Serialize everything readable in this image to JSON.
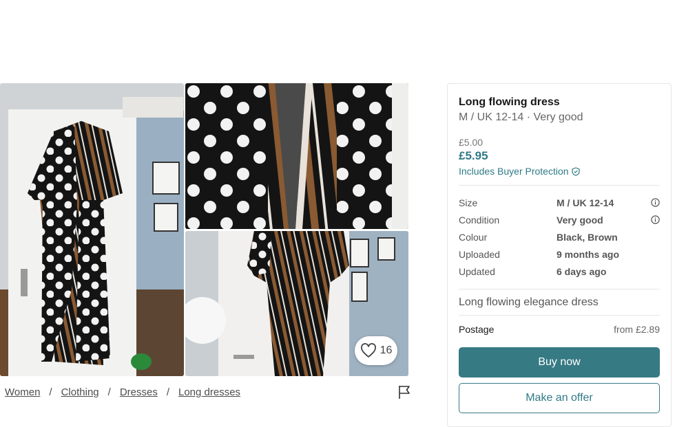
{
  "gallery": {
    "favourite_count": "16"
  },
  "breadcrumb": [
    "Women",
    "Clothing",
    "Dresses",
    "Long dresses"
  ],
  "item": {
    "title": "Long flowing dress",
    "subtitle": "M / UK 12-14 · Very good",
    "price": "£5.00",
    "price_with_protection": "£5.95",
    "protection_label": "Includes Buyer Protection",
    "attributes": [
      {
        "key": "Size",
        "value": "M / UK 12-14",
        "info": true
      },
      {
        "key": "Condition",
        "value": "Very good",
        "info": true
      },
      {
        "key": "Colour",
        "value": "Black, Brown",
        "info": false
      },
      {
        "key": "Uploaded",
        "value": "9 months ago",
        "info": false
      },
      {
        "key": "Updated",
        "value": "6 days ago",
        "info": false
      }
    ],
    "description": "Long flowing elegance dress",
    "postage_label": "Postage",
    "postage_value": "from £2.89"
  },
  "actions": {
    "buy_label": "Buy now",
    "offer_label": "Make an offer"
  },
  "colors": {
    "accent": "#367a84",
    "accent_text": "#2f7a86"
  }
}
